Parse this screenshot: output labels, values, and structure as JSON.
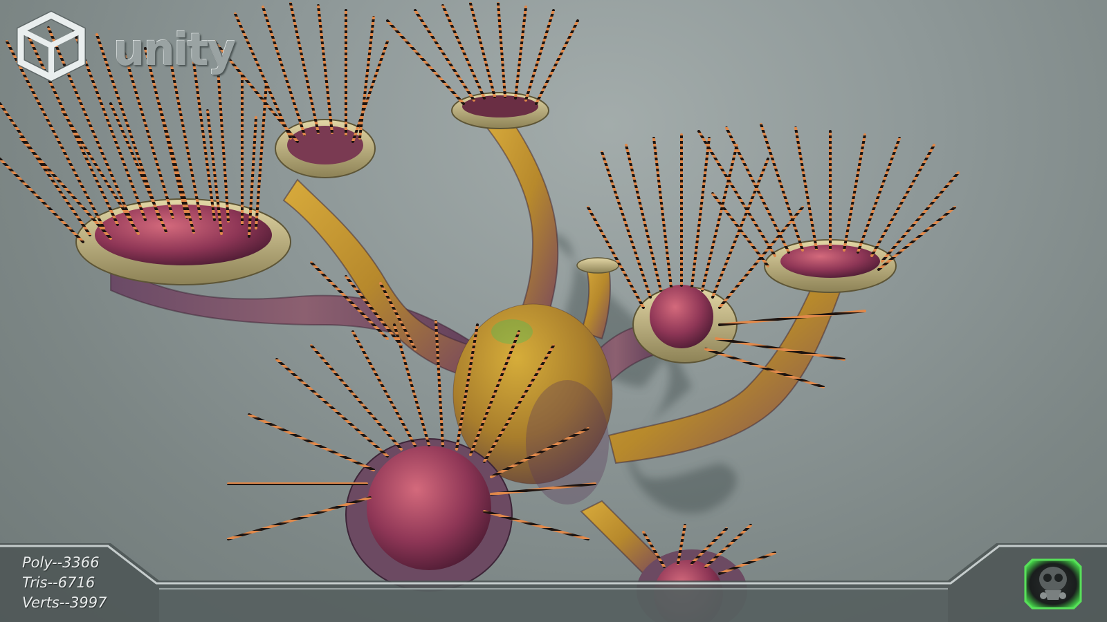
{
  "logo": {
    "text": "unity"
  },
  "stats": {
    "poly": "Poly--3366",
    "tris": "Tris--6716",
    "verts": "Verts--3997"
  },
  "colors": {
    "background": "#8e9898",
    "stalk": "#c99a2e",
    "bulb": "#a8486a",
    "spine_dark": "#1e1410",
    "spine_light": "#e08a4a",
    "rim": "#c7b98a",
    "badge_glow": "#46d64a"
  },
  "icons": {
    "logo_mark": "unity-cube-icon",
    "badge": "gas-mask-icon"
  }
}
